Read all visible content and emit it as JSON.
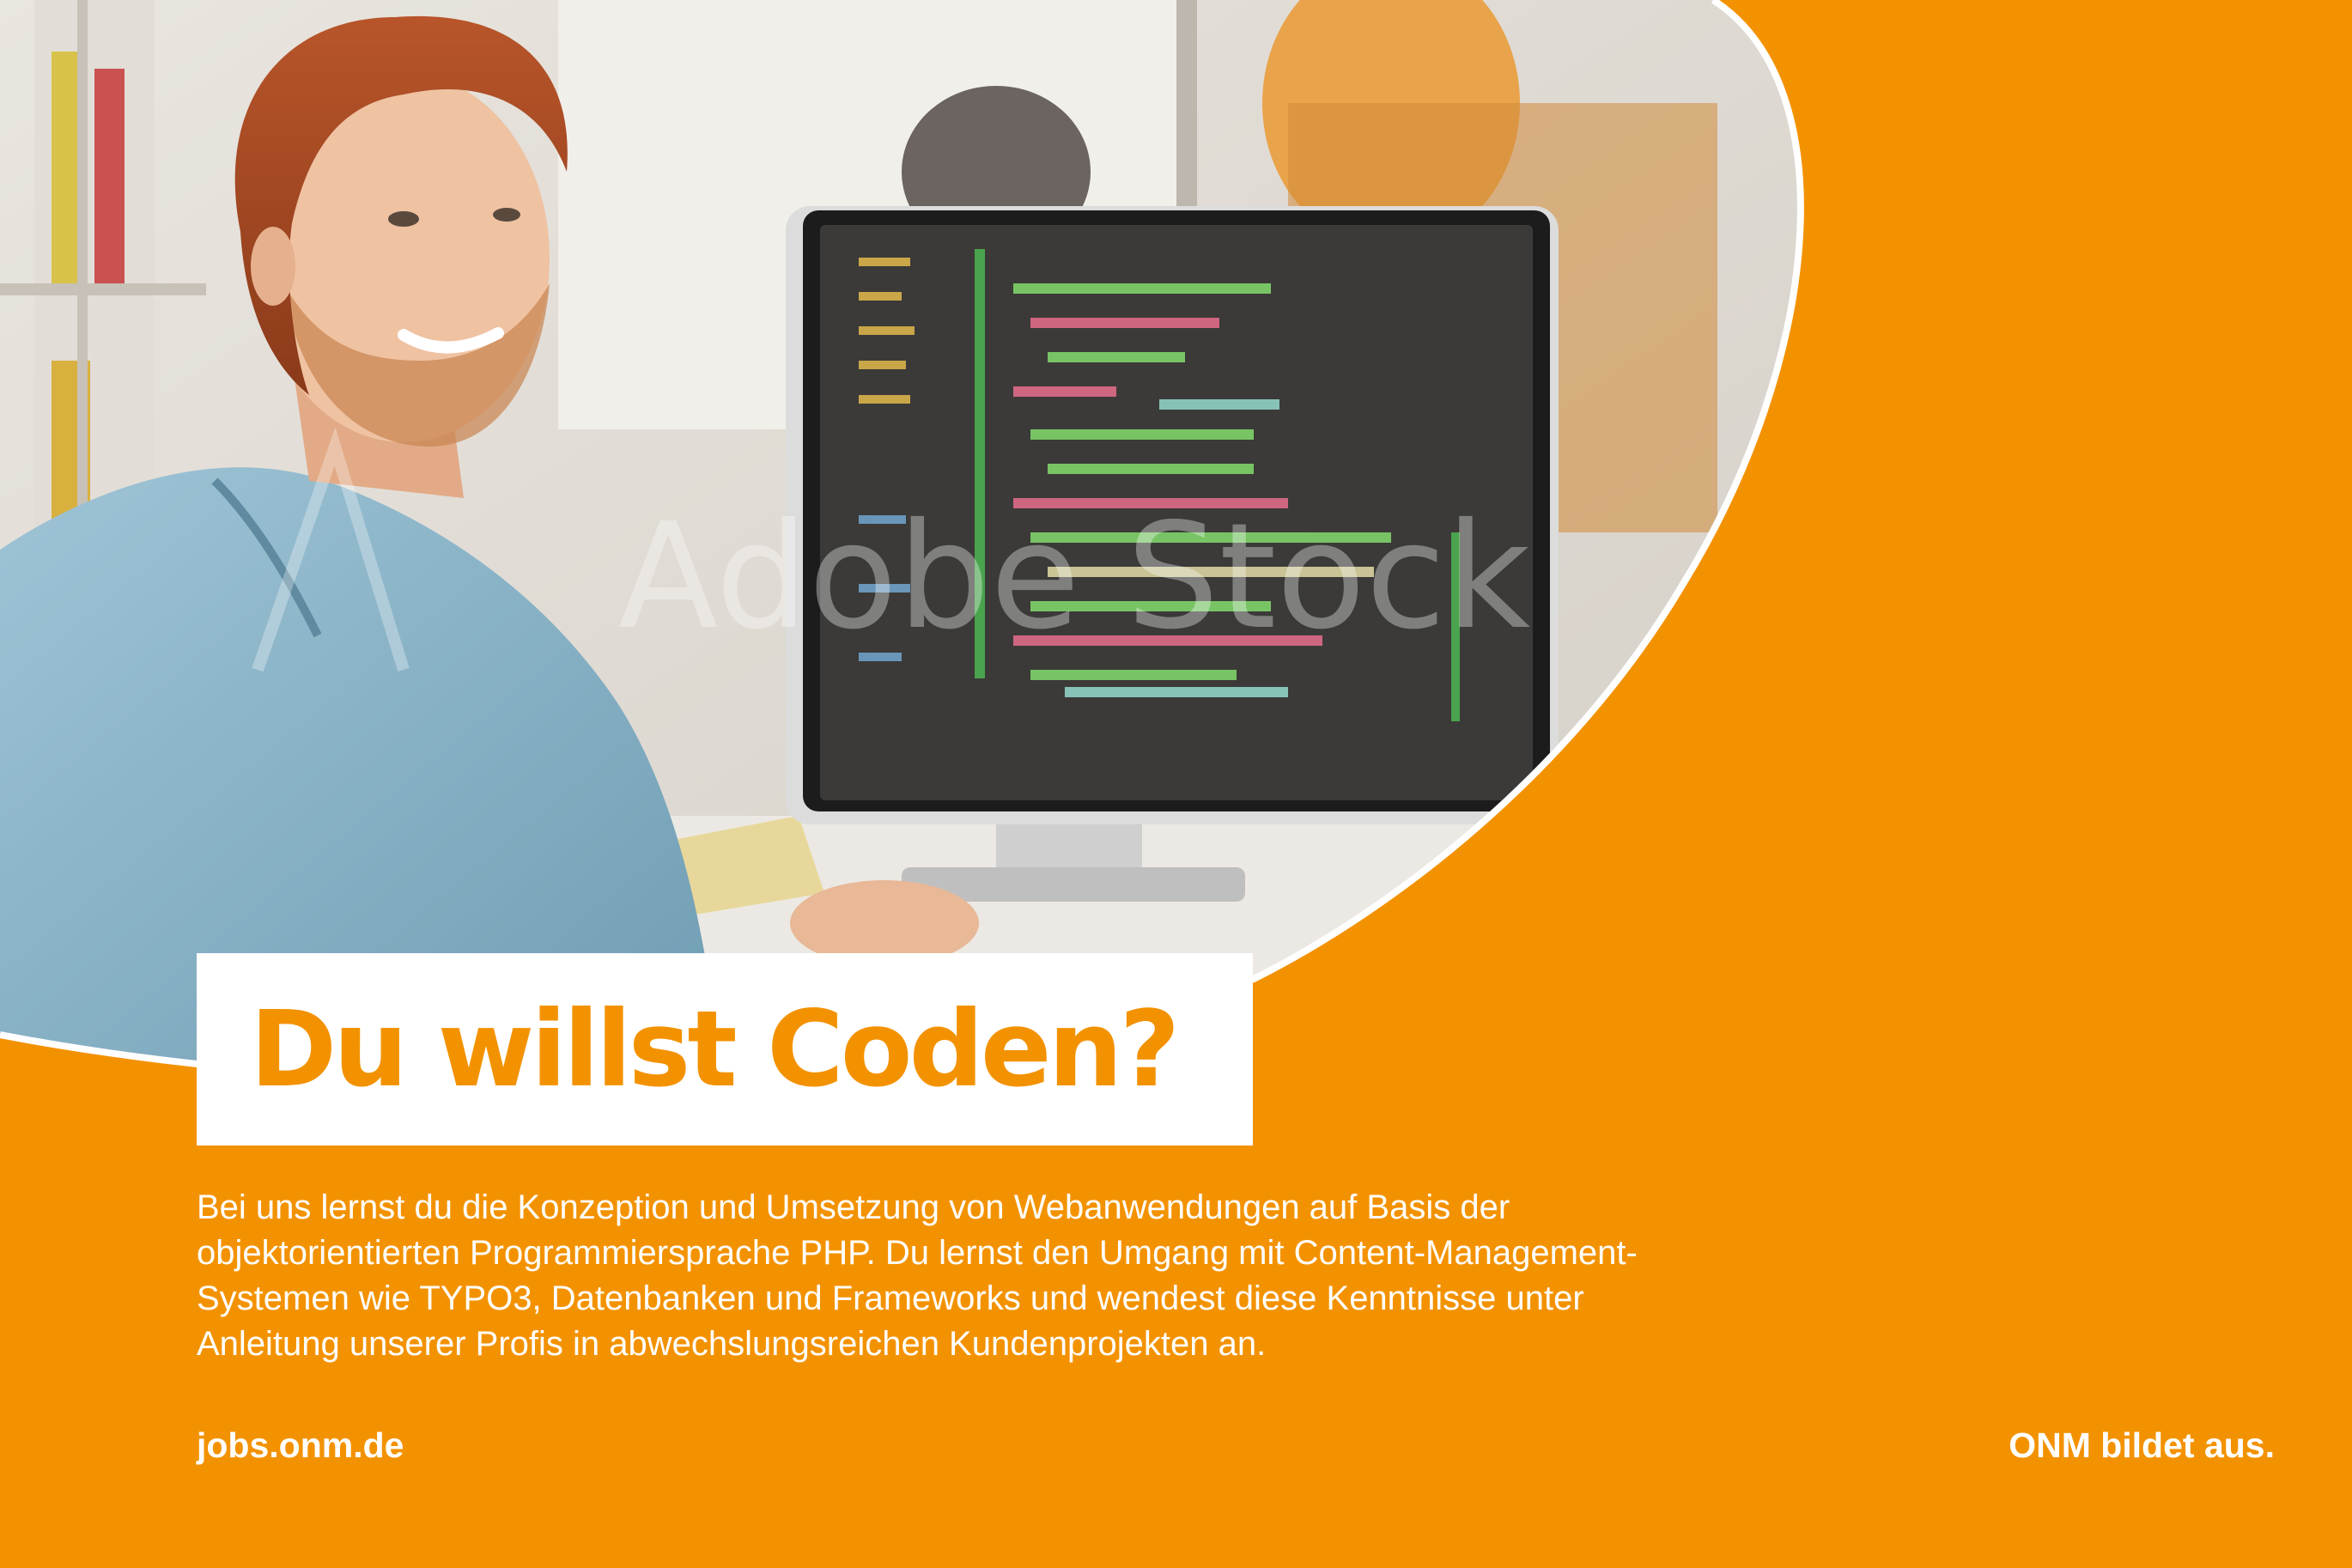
{
  "headline": "Du willst Coden?",
  "body_lines": [
    "Bei uns lernst du die Konzeption und Umsetzung von Webanwendungen auf Basis der",
    "objektorientierten Programmiersprache PHP. Du lernst den Umgang mit Content-Management-",
    "Systemen wie TYPO3, Datenbanken und Frameworks und wendest diese  Kenntnisse unter",
    "Anleitung unserer Profis in abwechslungsreichen Kundenprojekten an."
  ],
  "footer": {
    "url": "jobs.onm.de",
    "slogan": "ONM bildet aus."
  },
  "photo": {
    "watermark": "Adobe Stock"
  },
  "colors": {
    "brand_orange": "#F39200",
    "text_white": "#FFFFFF"
  }
}
